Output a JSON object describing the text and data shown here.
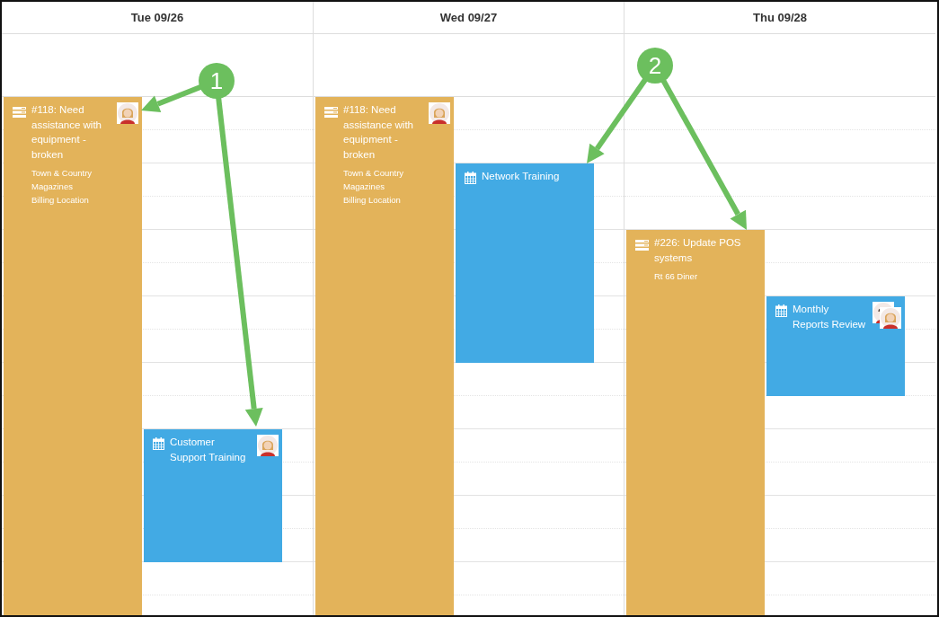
{
  "days": [
    {
      "label": "Tue 09/26",
      "events": [
        {
          "kind": "ticket",
          "title": "#118: Need assistance with equipment - broken",
          "details": [
            "Town & Country Magazines",
            "Billing Location"
          ],
          "avatars": [
            {
              "kind": "woman"
            }
          ]
        },
        {
          "kind": "meeting",
          "title": "Customer Support Training",
          "avatars": [
            {
              "kind": "woman"
            }
          ]
        }
      ]
    },
    {
      "label": "Wed 09/27",
      "events": [
        {
          "kind": "ticket",
          "title": "#118: Need assistance with equipment - broken",
          "details": [
            "Town & Country Magazines",
            "Billing Location"
          ],
          "avatars": [
            {
              "kind": "woman"
            }
          ]
        },
        {
          "kind": "meeting",
          "title": "Network Training"
        }
      ]
    },
    {
      "label": "Thu 09/28",
      "events": [
        {
          "kind": "ticket",
          "title": "#226: Update POS systems",
          "details": [
            "Rt 66 Diner"
          ]
        },
        {
          "kind": "meeting",
          "title": "Monthly Reports Review",
          "avatars": [
            {
              "kind": "man"
            },
            {
              "kind": "woman"
            }
          ]
        }
      ]
    }
  ],
  "callouts": [
    {
      "label": "1"
    },
    {
      "label": "2"
    }
  ]
}
